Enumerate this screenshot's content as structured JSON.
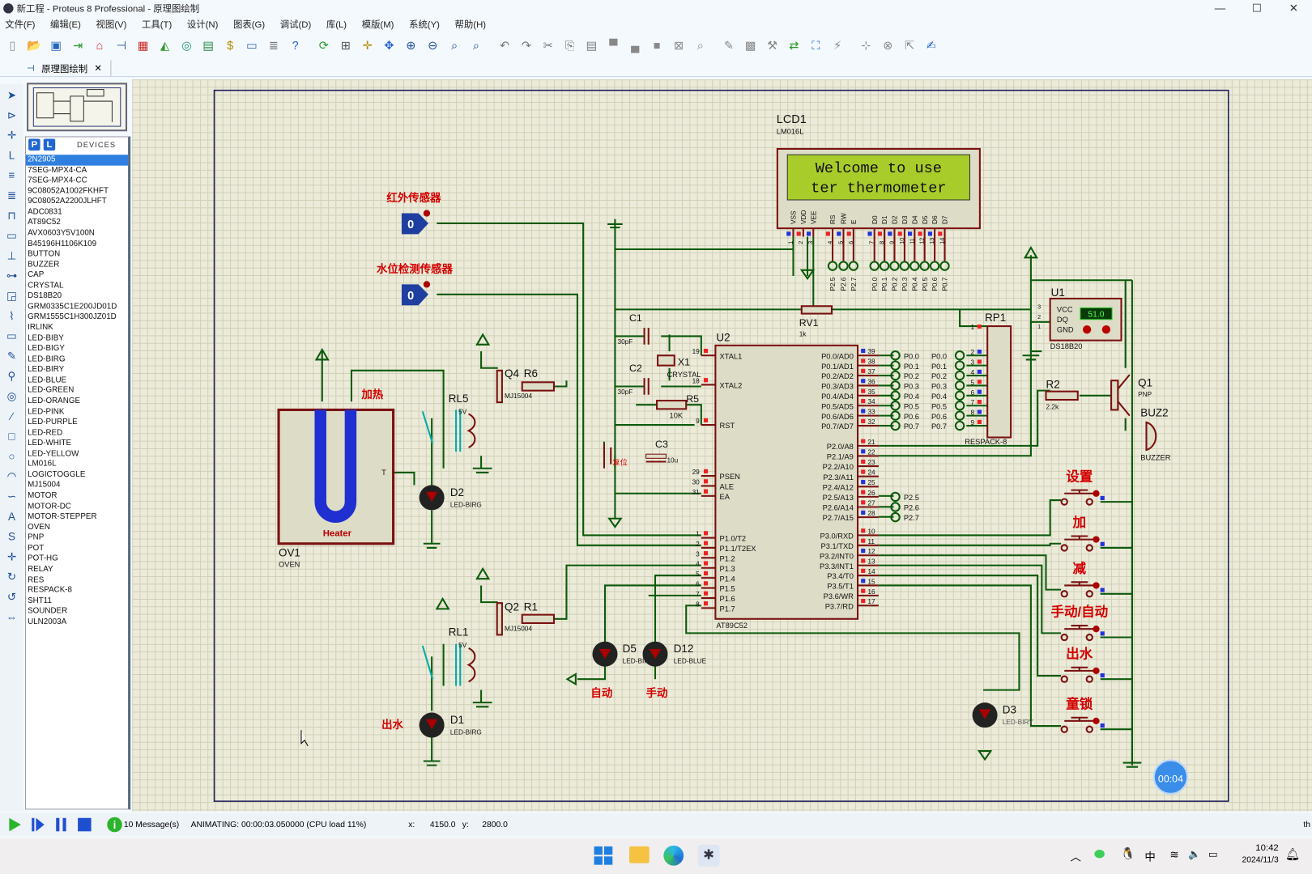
{
  "window": {
    "title": "新工程 - Proteus 8 Professional - 原理图绘制",
    "minimize": "—",
    "maximize": "☐",
    "close": "✕"
  },
  "menu": [
    "文件(F)",
    "编辑(E)",
    "视图(V)",
    "工具(T)",
    "设计(N)",
    "图表(G)",
    "调试(D)",
    "库(L)",
    "模版(M)",
    "系统(Y)",
    "帮助(H)"
  ],
  "toolbar": [
    {
      "icon": "new-file-icon",
      "glyph": "▯",
      "color": "#888"
    },
    {
      "icon": "open-folder-icon",
      "glyph": "📂",
      "color": "#d9a400"
    },
    {
      "icon": "save-icon",
      "glyph": "▣",
      "color": "#2466b8"
    },
    {
      "icon": "import-icon",
      "glyph": "⇥",
      "color": "#2a9a2a"
    },
    {
      "icon": "home-icon",
      "glyph": "⌂",
      "color": "#c22"
    },
    {
      "icon": "schematic-icon",
      "glyph": "⊣",
      "color": "#1b4f9c"
    },
    {
      "icon": "pcb-icon",
      "glyph": "▦",
      "color": "#c22"
    },
    {
      "icon": "3d-view-icon",
      "glyph": "◭",
      "color": "#2a9a2a"
    },
    {
      "icon": "gerber-icon",
      "glyph": "◎",
      "color": "#2a9a7a"
    },
    {
      "icon": "design-explorer-icon",
      "glyph": "▤",
      "color": "#1a8a3a"
    },
    {
      "icon": "bom-icon",
      "glyph": "$",
      "color": "#b38a00"
    },
    {
      "icon": "source-code-icon",
      "glyph": "▭",
      "color": "#3a6ab8"
    },
    {
      "icon": "notes-icon",
      "glyph": "≣",
      "color": "#777"
    },
    {
      "icon": "help-icon",
      "glyph": "?",
      "color": "#1f5fd1"
    },
    {
      "icon": "refresh-icon",
      "glyph": "⟳",
      "color": "#2a9a2a"
    },
    {
      "icon": "grid-icon",
      "glyph": "⊞",
      "color": "#555"
    },
    {
      "icon": "origin-icon",
      "glyph": "✛",
      "color": "#b38a00"
    },
    {
      "icon": "pan-icon",
      "glyph": "✥",
      "color": "#1f5fd1"
    },
    {
      "icon": "zoom-in-icon",
      "glyph": "⊕",
      "color": "#1b4f9c"
    },
    {
      "icon": "zoom-out-icon",
      "glyph": "⊖",
      "color": "#1b4f9c"
    },
    {
      "icon": "zoom-all-icon",
      "glyph": "⌕",
      "color": "#1b4f9c"
    },
    {
      "icon": "zoom-area-icon",
      "glyph": "⌕",
      "color": "#1b4f9c"
    },
    {
      "icon": "undo-icon",
      "glyph": "↶",
      "color": "#777"
    },
    {
      "icon": "redo-icon",
      "glyph": "↷",
      "color": "#777"
    },
    {
      "icon": "cut-icon",
      "glyph": "✂",
      "color": "#777"
    },
    {
      "icon": "copy-icon",
      "glyph": "⎘",
      "color": "#777"
    },
    {
      "icon": "paste-icon",
      "glyph": "▤",
      "color": "#777"
    },
    {
      "icon": "block-copy-icon",
      "glyph": "▀",
      "color": "#888"
    },
    {
      "icon": "block-move-icon",
      "glyph": "▄",
      "color": "#888"
    },
    {
      "icon": "block-rotate-icon",
      "glyph": "■",
      "color": "#888"
    },
    {
      "icon": "block-delete-icon",
      "glyph": "⊠",
      "color": "#888"
    },
    {
      "icon": "pick-device-icon",
      "glyph": "⌕",
      "color": "#888"
    },
    {
      "icon": "make-device-icon",
      "glyph": "✎",
      "color": "#888"
    },
    {
      "icon": "packaging-icon",
      "glyph": "▩",
      "color": "#888"
    },
    {
      "icon": "decompose-icon",
      "glyph": "⚒",
      "color": "#888"
    },
    {
      "icon": "wire-autorouter-icon",
      "glyph": "⇄",
      "color": "#2a9a2a"
    },
    {
      "icon": "search-tag-icon",
      "glyph": "⛶",
      "color": "#1f5fd1"
    },
    {
      "icon": "property-assignment-icon",
      "glyph": "⚡",
      "color": "#888"
    },
    {
      "icon": "new-sheet-icon",
      "glyph": "⊹",
      "color": "#888"
    },
    {
      "icon": "delete-sheet-icon",
      "glyph": "⊗",
      "color": "#888"
    },
    {
      "icon": "goto-sheet-icon",
      "glyph": "⇱",
      "color": "#888"
    },
    {
      "icon": "netlist-icon",
      "glyph": "✍",
      "color": "#1f5fd1"
    }
  ],
  "tab": {
    "label": "原理图绘制",
    "close": "✕"
  },
  "left_tools": [
    "selection-mode-icon",
    "component-mode-icon",
    "junction-dot-icon",
    "wire-label-icon",
    "text-script-icon",
    "bus-icon",
    "subcircuit-icon",
    "terminals-icon",
    "device-pins-icon",
    "graph-icon",
    "tape-recorder-icon",
    "generator-icon",
    "voltage-probe-icon",
    "current-probe-icon",
    "virtual-instrument-icon",
    "line-icon",
    "box-icon",
    "circle-icon",
    "arc-icon",
    "path-icon",
    "text-icon",
    "symbol-icon",
    "marker-icon",
    "rotate-cw-icon",
    "rotate-ccw-icon",
    "mirror-x-icon",
    "mirror-y-icon"
  ],
  "devices": {
    "p": "P",
    "l": "L",
    "header": "DEVICES",
    "selected": 0,
    "items": [
      "2N2905",
      "7SEG-MPX4-CA",
      "7SEG-MPX4-CC",
      "9C08052A1002FKHFT",
      "9C08052A2200JLHFT",
      "ADC0831",
      "AT89C52",
      "AVX0603Y5V100N",
      "B45196H1106K109",
      "BUTTON",
      "BUZZER",
      "CAP",
      "CRYSTAL",
      "DS18B20",
      "GRM0335C1E200JD01D",
      "GRM1555C1H300JZ01D",
      "IRLINK",
      "LED-BIBY",
      "LED-BIGY",
      "LED-BIRG",
      "LED-BIRY",
      "LED-BLUE",
      "LED-GREEN",
      "LED-ORANGE",
      "LED-PINK",
      "LED-PURPLE",
      "LED-RED",
      "LED-WHITE",
      "LED-YELLOW",
      "LM016L",
      "LOGICTOGGLE",
      "MJ15004",
      "MOTOR",
      "MOTOR-DC",
      "MOTOR-STEPPER",
      "OVEN",
      "PNP",
      "POT",
      "POT-HG",
      "RELAY",
      "RES",
      "RESPACK-8",
      "SHT11",
      "SOUNDER",
      "ULN2003A"
    ]
  },
  "schematic": {
    "lcd": {
      "ref": "LCD1",
      "part": "LM016L",
      "line1": "Welcome to use",
      "line2": "ter thermometer",
      "pins": [
        "VSS",
        "VDD",
        "VEE",
        "RS",
        "RW",
        "E",
        "D0",
        "D1",
        "D2",
        "D3",
        "D4",
        "D5",
        "D6",
        "D7"
      ],
      "nums": [
        "1",
        "2",
        "3",
        "4",
        "5",
        "6",
        "7",
        "8",
        "9",
        "10",
        "11",
        "12",
        "13",
        "14"
      ],
      "nets": [
        "P2.5",
        "P2.6",
        "P2.7",
        "P0.0",
        "P0.1",
        "P0.2",
        "P0.3",
        "P0.4",
        "P0.5",
        "P0.6",
        "P0.7"
      ]
    },
    "sensors": [
      {
        "label": "红外传感器",
        "value": "0"
      },
      {
        "label": "水位检测传感器",
        "value": "0"
      }
    ],
    "mcu": {
      "ref": "U2",
      "part": "AT89C52",
      "left": [
        [
          "XTAL1",
          "19"
        ],
        [
          "XTAL2",
          "18"
        ],
        [
          "RST",
          "9"
        ],
        [
          "PSEN",
          "29"
        ],
        [
          "ALE",
          "30"
        ],
        [
          "EA",
          "31"
        ],
        [
          "P1.0/T2",
          "1"
        ],
        [
          "P1.1/T2EX",
          "2"
        ],
        [
          "P1.2",
          "3"
        ],
        [
          "P1.3",
          "4"
        ],
        [
          "P1.4",
          "5"
        ],
        [
          "P1.5",
          "6"
        ],
        [
          "P1.6",
          "7"
        ],
        [
          "P1.7",
          "8"
        ]
      ],
      "right": [
        [
          "P0.0/AD0",
          "39"
        ],
        [
          "P0.1/AD1",
          "38"
        ],
        [
          "P0.2/AD2",
          "37"
        ],
        [
          "P0.3/AD3",
          "36"
        ],
        [
          "P0.4/AD4",
          "35"
        ],
        [
          "P0.5/AD5",
          "34"
        ],
        [
          "P0.6/AD6",
          "33"
        ],
        [
          "P0.7/AD7",
          "32"
        ],
        [
          "P2.0/A8",
          "21"
        ],
        [
          "P2.1/A9",
          "22"
        ],
        [
          "P2.2/A10",
          "23"
        ],
        [
          "P2.3/A11",
          "24"
        ],
        [
          "P2.4/A12",
          "25"
        ],
        [
          "P2.5/A13",
          "26"
        ],
        [
          "P2.6/A14",
          "27"
        ],
        [
          "P2.7/A15",
          "28"
        ],
        [
          "P3.0/RXD",
          "10"
        ],
        [
          "P3.1/TXD",
          "11"
        ],
        [
          "P3.2/INT0",
          "12"
        ],
        [
          "P3.3/INT1",
          "13"
        ],
        [
          "P3.4/T0",
          "14"
        ],
        [
          "P3.5/T1",
          "15"
        ],
        [
          "P3.6/WR",
          "16"
        ],
        [
          "P3.7/RD",
          "17"
        ]
      ],
      "p0_nets": [
        "P0.0",
        "P0.1",
        "P0.2",
        "P0.3",
        "P0.4",
        "P0.5",
        "P0.6",
        "P0.7"
      ],
      "p2_nets": [
        "P2.5",
        "P2.6",
        "P2.7"
      ]
    },
    "crystal": {
      "c1": "C1",
      "c1_val": "30pF",
      "c2": "C2",
      "c2_val": "30pF",
      "x1": "X1",
      "x1_val": "CRYSTAL",
      "r5": "R5",
      "r5_val": "10K",
      "c3": "C3",
      "c3_val": "10u",
      "reset": "复位"
    },
    "rv1": {
      "ref": "RV1",
      "val": "1k"
    },
    "rp1": {
      "ref": "RP1",
      "part": "RESPACK-8",
      "nums": [
        "1",
        "2",
        "3",
        "4",
        "5",
        "6",
        "7",
        "8",
        "9"
      ]
    },
    "u1": {
      "ref": "U1",
      "part": "DS18B20",
      "pins": [
        "VCC",
        "DQ",
        "GND"
      ],
      "nums": [
        "3",
        "2",
        "1"
      ],
      "reading": "51.0"
    },
    "r2": {
      "ref": "R2",
      "val": "2.2k"
    },
    "q1": {
      "ref": "Q1",
      "part": "PNP"
    },
    "buzzer": {
      "ref": "BUZ2",
      "part": "BUZZER"
    },
    "buttons": [
      "设置",
      "加",
      "减",
      "手动/自动",
      "出水",
      "童锁"
    ],
    "d3": {
      "ref": "D3",
      "part": "LED-BIRY"
    },
    "d5": {
      "ref": "D5",
      "part": "LED-BIRY",
      "label": "自动"
    },
    "d12": {
      "ref": "D12",
      "part": "LED-BLUE",
      "label": "手动"
    },
    "heat": {
      "q": "Q4",
      "q_part": "MJ15004",
      "r": "R6",
      "rl": "RL5",
      "rl_val": "5V",
      "label": "加热",
      "d": "D2",
      "d_part": "LED-BIRG"
    },
    "oven": {
      "ref": "OV1",
      "part": "OVEN",
      "name": "Heater",
      "t": "T"
    },
    "water": {
      "q": "Q2",
      "q_part": "MJ15004",
      "r": "R1",
      "rl": "RL1",
      "rl_val": "5V",
      "label": "出水",
      "d": "D1",
      "d_part": "LED-BIRG"
    },
    "timer": "00:04"
  },
  "status": {
    "messages": "10 Message(s)",
    "animating": "ANIMATING: 00:00:03.050000 (CPU load 11%)",
    "x_label": "x:",
    "x": "4150.0",
    "y_label": "y:",
    "y": "2800.0",
    "extra": "th"
  },
  "taskbar": {
    "time": "10:42",
    "date": "2024/11/3",
    "ime": "中"
  },
  "colors": {
    "wire": "#0b5a0b",
    "component": "#7a1010",
    "body": "#dddcc6",
    "lcd_screen": "#a8cc2a",
    "label_red": "#d40000",
    "grid": "#ecebd9"
  }
}
